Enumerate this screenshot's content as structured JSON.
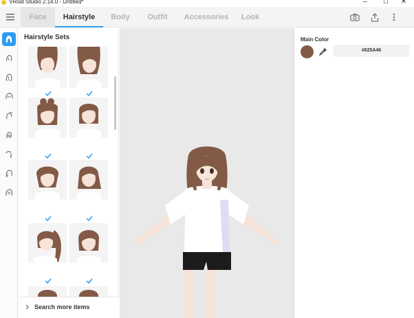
{
  "window": {
    "title": "VRoid Studio 2.14.0 - Untitled*",
    "controls": [
      "–",
      "☐",
      "✕"
    ]
  },
  "tabs": [
    {
      "label": "Face",
      "active": false
    },
    {
      "label": "Hairstyle",
      "active": true
    },
    {
      "label": "Body",
      "active": false
    },
    {
      "label": "Outfit",
      "active": false
    },
    {
      "label": "Accessories",
      "active": false
    },
    {
      "label": "Look",
      "active": false
    }
  ],
  "toolbar_icons": [
    "camera-icon",
    "export-icon",
    "more-vertical-icon"
  ],
  "rail": {
    "items": [
      "hairstyle-icon",
      "front-hair-icon",
      "back-hair-icon",
      "side-hair-icon",
      "ahoge-icon",
      "hair-extension-icon",
      "braid-icon",
      "sideburn-icon",
      "base-hair-icon"
    ],
    "active_index": 0
  },
  "hairstyle_sets": {
    "title": "Hairstyle Sets",
    "search_more": "Search more items"
  },
  "main_color": {
    "label": "Main Color",
    "hex": "#825A46"
  },
  "colors": {
    "accent": "#2e9bf0",
    "hair": "#825A46",
    "viewport_bg": "#e9e9e9"
  }
}
